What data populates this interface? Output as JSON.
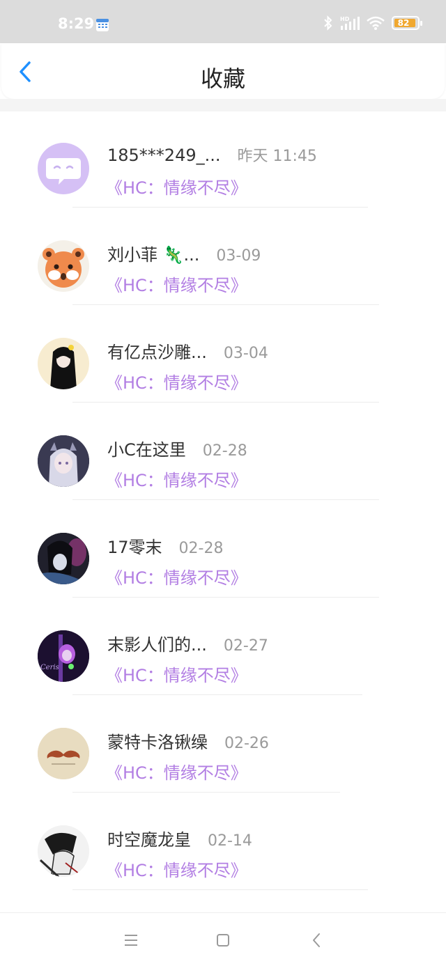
{
  "status_bar": {
    "time": "8:29",
    "battery": "82",
    "icons": [
      "calendar-icon",
      "bluetooth-icon",
      "hd-signal-icon",
      "wifi-icon",
      "battery-icon"
    ]
  },
  "header": {
    "title": "收藏",
    "back_icon": "chevron-left-icon"
  },
  "favorites": [
    {
      "name": "185***249_...",
      "time": "昨天 11:45",
      "subtitle": "《HC：情缘不尽》",
      "avatar": "default-chat-avatar"
    },
    {
      "name": "刘小菲 🦎...",
      "time": "03-09",
      "subtitle": "《HC：情缘不尽》",
      "avatar": "red-panda-avatar"
    },
    {
      "name": "有亿点沙雕...",
      "time": "03-04",
      "subtitle": "《HC：情缘不尽》",
      "avatar": "dark-figure-avatar"
    },
    {
      "name": "小C在这里",
      "time": "02-28",
      "subtitle": "《HC：情缘不尽》",
      "avatar": "anime-girl-avatar"
    },
    {
      "name": "17零末",
      "time": "02-28",
      "subtitle": "《HC：情缘不尽》",
      "avatar": "dark-anime-avatar"
    },
    {
      "name": "末影人们的...",
      "time": "02-27",
      "subtitle": "《HC：情缘不尽》",
      "avatar": "purple-character-avatar",
      "avatar_text": "Ceris"
    },
    {
      "name": "蒙特卡洛锹缲",
      "time": "02-26",
      "subtitle": "《HC：情缘不尽》",
      "avatar": "mustache-avatar"
    },
    {
      "name": "时空魔龙皇",
      "time": "02-14",
      "subtitle": "《HC：情缘不尽》",
      "avatar": "sketch-avatar"
    }
  ],
  "nav_bar": {
    "icons": [
      "menu-icon",
      "home-icon",
      "back-icon"
    ]
  },
  "colors": {
    "accent_blue": "#1e90ff",
    "subtitle_purple": "#b27ee3",
    "status_bar_bg": "#dcdcdc",
    "battery_orange": "#f0a830"
  }
}
